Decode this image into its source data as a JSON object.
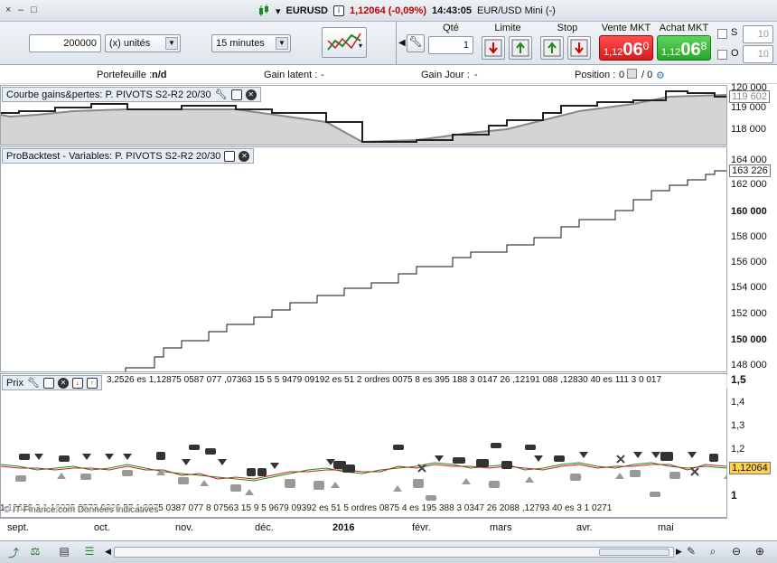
{
  "window": {
    "controls": [
      "×",
      "–",
      "□"
    ],
    "symbol": "EURUSD",
    "price": "1,12064 (-0,09%)",
    "time": "14:43:05",
    "instrument": "EUR/USD Mini (-)"
  },
  "toolbar": {
    "quantity": "200000",
    "unit_select": "(x) unités",
    "timeframe_select": "15 minutes",
    "qty_label": "Qté",
    "qty_value": "1",
    "limit_label": "Limite",
    "stop_label": "Stop",
    "sell_label": "Vente MKT",
    "buy_label": "Achat MKT",
    "sell_price_prefix": "1,12",
    "sell_price_big": "06",
    "sell_price_sup": "0",
    "buy_price_prefix": "1,12",
    "buy_price_big": "06",
    "buy_price_sup": "8",
    "s_label": "S",
    "o_label": "O",
    "s_value": "10",
    "o_value": "10"
  },
  "infobar": {
    "portfolio_label": "Portefeuille :",
    "portfolio_value": "n/d",
    "latent_label": "Gain latent :",
    "latent_value": "-",
    "day_label": "Gain Jour :",
    "day_value": "-",
    "position_label": "Position :",
    "position_value": "0",
    "position_sep": "/ 0"
  },
  "panels": {
    "gains_title": "Courbe gains&pertes: P. PIVOTS S2-R2 20/30",
    "gains_last": "119 602",
    "gains_ticks": [
      "120 000",
      "119 000",
      "118 000"
    ],
    "backtest_title": "ProBacktest - Variables: P. PIVOTS S2-R2 20/30",
    "backtest_last": "163 226",
    "backtest_ticks": [
      "164 000",
      "162 000",
      "160 000",
      "158 000",
      "156 000",
      "154 000",
      "152 000",
      "150 000",
      "148 000"
    ],
    "price_title": "Prix",
    "price_last": "1,12064",
    "price_ticks": [
      "1,5",
      "1,4",
      "1,3",
      "1,2",
      "1,1",
      "1"
    ],
    "orders_text_top": "3,2526 es 1,12875 0587 077 ,07363 15 5 5 9479 09192 es 51 2 ordres 0075 8 es 395 188 3 0147 26 ,12191 088 ,12830 40 es 111 3 0 017",
    "orders_text_bottom": "1,12628 3 1,16025 0573 0326 57 1,3975 0387 077 8 07563 15 9 5 9679 09392 es 51 5 ordres 0875 4 es 195 388 3 0347 26 2088 ,12793 40 es 3 1 0271",
    "watermark": "© IT-Finance.com Données indicatives"
  },
  "xaxis": {
    "labels": [
      "sept.",
      "oct.",
      "nov.",
      "déc.",
      "2016",
      "févr.",
      "mars",
      "avr.",
      "mai"
    ]
  }
}
